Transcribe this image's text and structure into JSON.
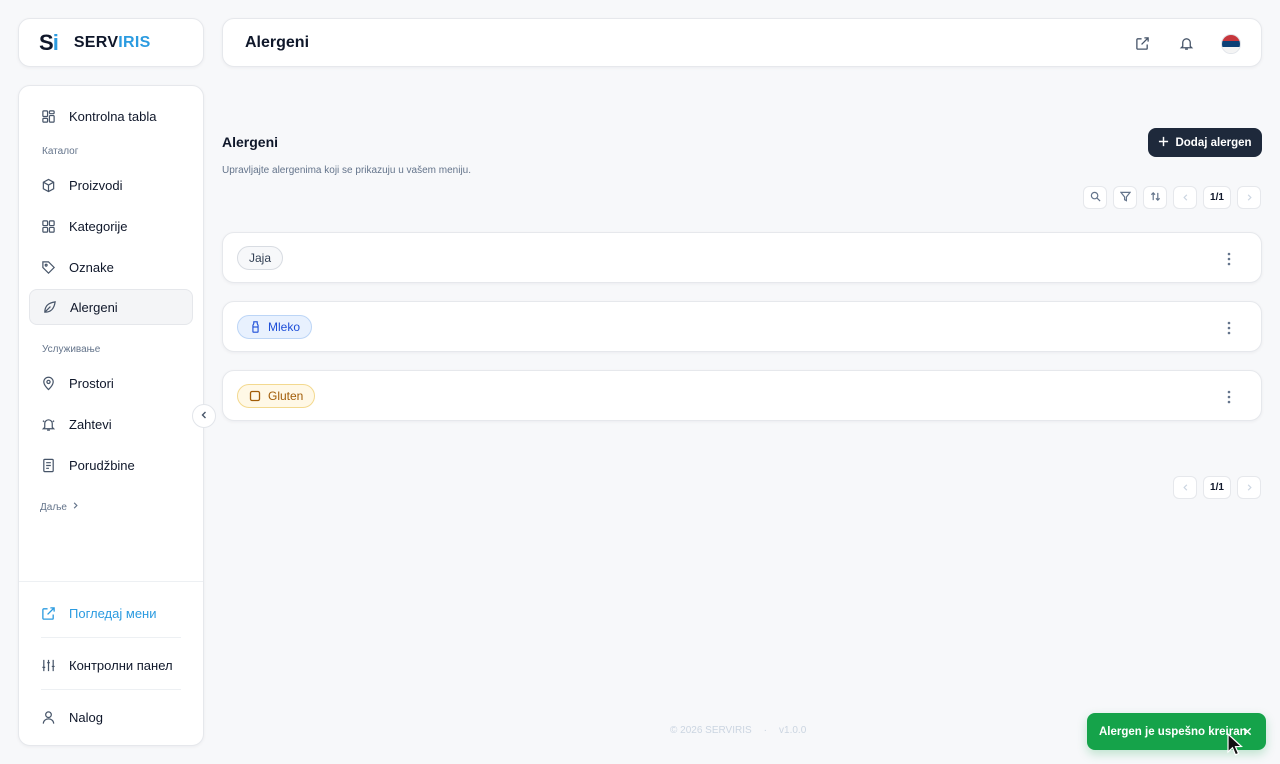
{
  "logo": {
    "mark_s": "S",
    "mark_i": "i",
    "name_a": "SERV",
    "name_b": "IRIS"
  },
  "sidebar": {
    "items": [
      {
        "label": "Kontrolna tabla",
        "icon": "dashboard-icon"
      },
      {
        "label": "Proizvodi",
        "icon": "box-icon"
      },
      {
        "label": "Kategorije",
        "icon": "grid-icon"
      },
      {
        "label": "Oznake",
        "icon": "tag-icon"
      },
      {
        "label": "Alergeni",
        "icon": "leaf-icon",
        "active": true
      },
      {
        "label": "Prostori",
        "icon": "map-pin-icon"
      },
      {
        "label": "Zahtevi",
        "icon": "bell-icon"
      },
      {
        "label": "Porudžbine",
        "icon": "receipt-icon"
      }
    ],
    "section_catalog": "Каталог",
    "section_service": "Услуживање",
    "more": "Даље",
    "bottom": {
      "view_menu": "Погледај мени",
      "control_panel": "Контролни панел",
      "account": "Nalog"
    }
  },
  "header": {
    "title": "Alergeni"
  },
  "main": {
    "title": "Alergeni",
    "subtitle": "Upravljajte alergenima koji se prikazuju u vašem meniju.",
    "add_button": "Dodaj alergen",
    "pagination_top": "1/1",
    "pagination_bottom": "1/1",
    "rows": [
      {
        "label": "Jaja",
        "style": "gray"
      },
      {
        "label": "Mleko",
        "style": "blue",
        "icon": "bottle-icon"
      },
      {
        "label": "Gluten",
        "style": "amber",
        "icon": "square-icon"
      }
    ]
  },
  "footer": {
    "copyright": "© 2026 SERVIRIS",
    "sep": "·",
    "version": "v1.0.0"
  },
  "toast": {
    "message": "Alergen je uspešno kreiran",
    "color": "#15a34a"
  },
  "colors": {
    "brand": "#2b9be0",
    "primary_button": "#1e293b"
  }
}
